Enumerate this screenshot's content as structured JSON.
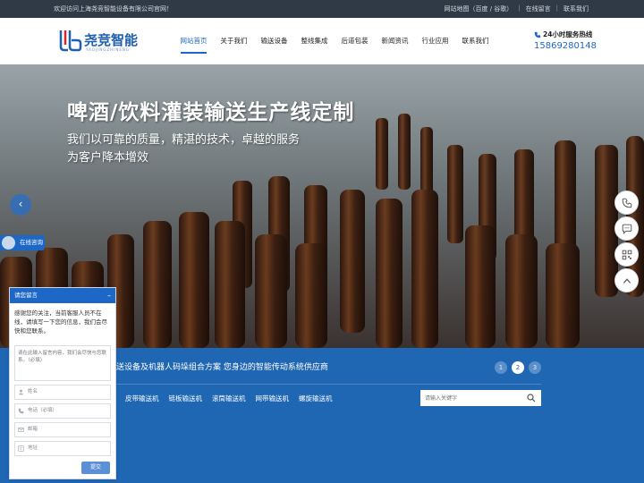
{
  "topbar": {
    "welcome": "欢迎访问上海尧竞智能设备有限公司官网！",
    "links": [
      "网站地图（百度 / 谷歌）",
      "在线留言",
      "联系我们"
    ]
  },
  "header": {
    "brand": "尧竞智能",
    "brand_sub": "YAOJINGZHINENG",
    "nav": [
      "网站首页",
      "关于我们",
      "输送设备",
      "整线集成",
      "后道包装",
      "新闻资讯",
      "行业应用",
      "联系我们"
    ],
    "active_nav": "网站首页",
    "hotline_label": "24小时服务热线",
    "hotline_number": "15869280148"
  },
  "banner": {
    "title": "啤酒/饮料灌装输送生产线定制",
    "subtitle_line1": "我们以可靠的质量，精湛的技术，卓越的服务",
    "subtitle_line2": "为客户降本增效",
    "prev_icon": "chevron-left-icon"
  },
  "bluebar": {
    "slogan": "送设备及机器人码垛组合方案 您身边的智能传动系统供应商",
    "dots": [
      "1",
      "2",
      "3"
    ],
    "active_dot": "2",
    "categories": [
      "皮带输送机",
      "链板输送机",
      "滚筒输送机",
      "网带输送机",
      "螺旋输送机"
    ],
    "search_placeholder": "请输入关键字"
  },
  "side_tools": [
    "phone-icon",
    "chat-icon",
    "qrcode-icon",
    "back-to-top-icon"
  ],
  "chat": {
    "button_label": "在线咨询",
    "panel_title": "请您留言",
    "minimize": "–",
    "message": "感谢您的关注，当前客服人员不在线，请填写一下您的信息，我们会尽快和您联系。",
    "textarea_placeholder": "请在此输入留言内容，我们会尽快与您联系。（必填）",
    "fields": [
      "姓名",
      "电话（必填）",
      "邮箱",
      "地址"
    ],
    "submit_label": "提交"
  },
  "colors": {
    "accent": "#1d68c7",
    "bluebar": "#1f66b3",
    "topbar": "#2f3a46"
  }
}
